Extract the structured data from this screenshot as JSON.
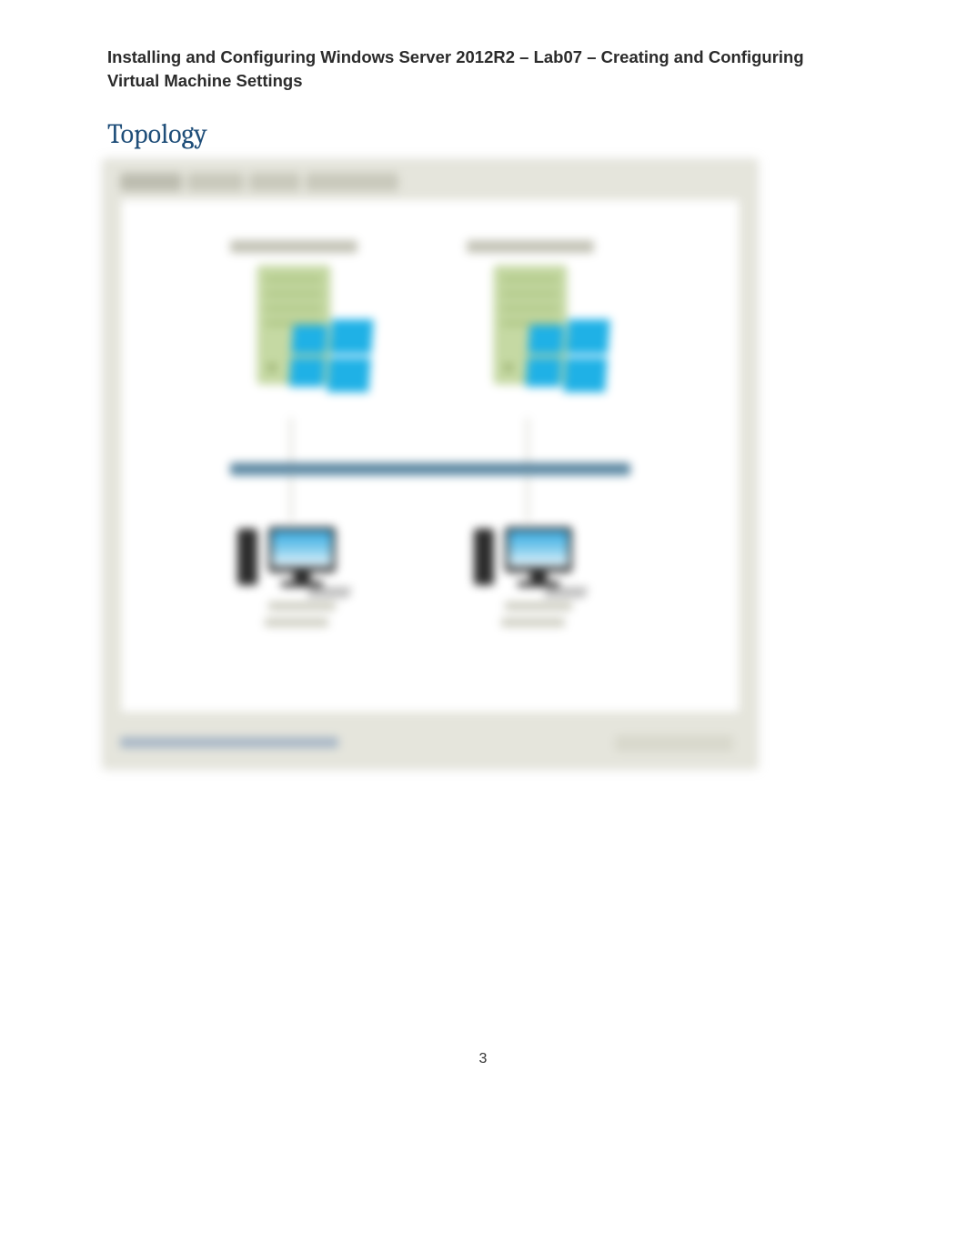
{
  "header": {
    "title": "Installing and Configuring Windows Server 2012R2 – Lab07 – Creating and Configuring Virtual Machine Settings"
  },
  "section": {
    "heading": "Topology"
  },
  "page": {
    "number": "3"
  }
}
